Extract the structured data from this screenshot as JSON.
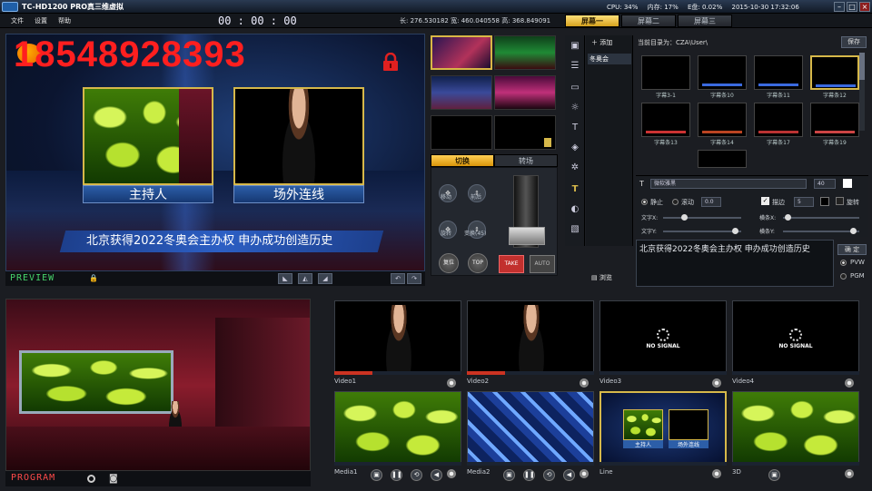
{
  "titlebar": {
    "title": "TC-HD1200 PRO真三维虚拟",
    "cpu": "CPU: 34%",
    "memory": "内存: 17%",
    "e_disk": "E盘: 0.02%",
    "datetime": "2015-10-30   17:32:06"
  },
  "menu": {
    "file": "文件",
    "settings": "设置",
    "help": "帮助",
    "timer": "00 : 00 : 00",
    "coords": "长: 276.530182  宽: 460.040558  高: 368.849091"
  },
  "screen_tabs": [
    "屏幕一",
    "屏幕二",
    "屏幕三"
  ],
  "preview": {
    "watermark_phone": "18548928393",
    "caption_left": "主持人",
    "caption_right": "场外连线",
    "ticker": "北京获得2022冬奥会主办权 申办成功创造历史",
    "label": "PREVIEW"
  },
  "switch": {
    "tab_cut": "切换",
    "tab_transition": "转场",
    "move": "移动",
    "front_back": "前后",
    "rotate": "旋转",
    "transform": "变换(45)",
    "reset": "复位",
    "top": "TOP",
    "take": "TAKE",
    "auto": "AUTO"
  },
  "right_panel": {
    "add": "添加",
    "layer_name": "冬奥会",
    "browse": "浏览",
    "current_dir": "当前目录为：CZA\\User\\",
    "save": "保存",
    "subtitles": [
      "字幕3-1",
      "字幕条10",
      "字幕条11",
      "字幕条12",
      "字幕条13",
      "字幕条14",
      "字幕条17",
      "字幕条19"
    ],
    "font_name": "微软雅黑",
    "font_size": "40",
    "static": "静止",
    "scroll": "滚动",
    "speed": "0.0",
    "outline": "描边",
    "outline_width": "5",
    "rotate": "旋转",
    "text_x": "文字X:",
    "text_y": "文字Y:",
    "bar_x": "横条X:",
    "bar_y": "横条Y:",
    "text_content": "北京获得2022冬奥会主办权  申办成功创造历史",
    "confirm": "确 定",
    "pvw": "PVW",
    "pgm": "PGM"
  },
  "program": {
    "label": "PROGRAM"
  },
  "sources": [
    {
      "label": "Video1",
      "signal": ""
    },
    {
      "label": "Video2",
      "signal": ""
    },
    {
      "label": "Video3",
      "signal": "NO SIGNAL"
    },
    {
      "label": "Video4",
      "signal": "NO SIGNAL"
    },
    {
      "label": "Media1",
      "signal": ""
    },
    {
      "label": "Media2",
      "signal": ""
    },
    {
      "label": "Line",
      "signal": ""
    },
    {
      "label": "3D",
      "signal": ""
    }
  ],
  "line_thumb": {
    "left": "主持人",
    "right": "场外连线"
  },
  "colors": {
    "accent_gold": "#d6b84a",
    "preview_green": "#46d36a",
    "program_red": "#ff4a4a",
    "take_red": "#c2302e"
  }
}
